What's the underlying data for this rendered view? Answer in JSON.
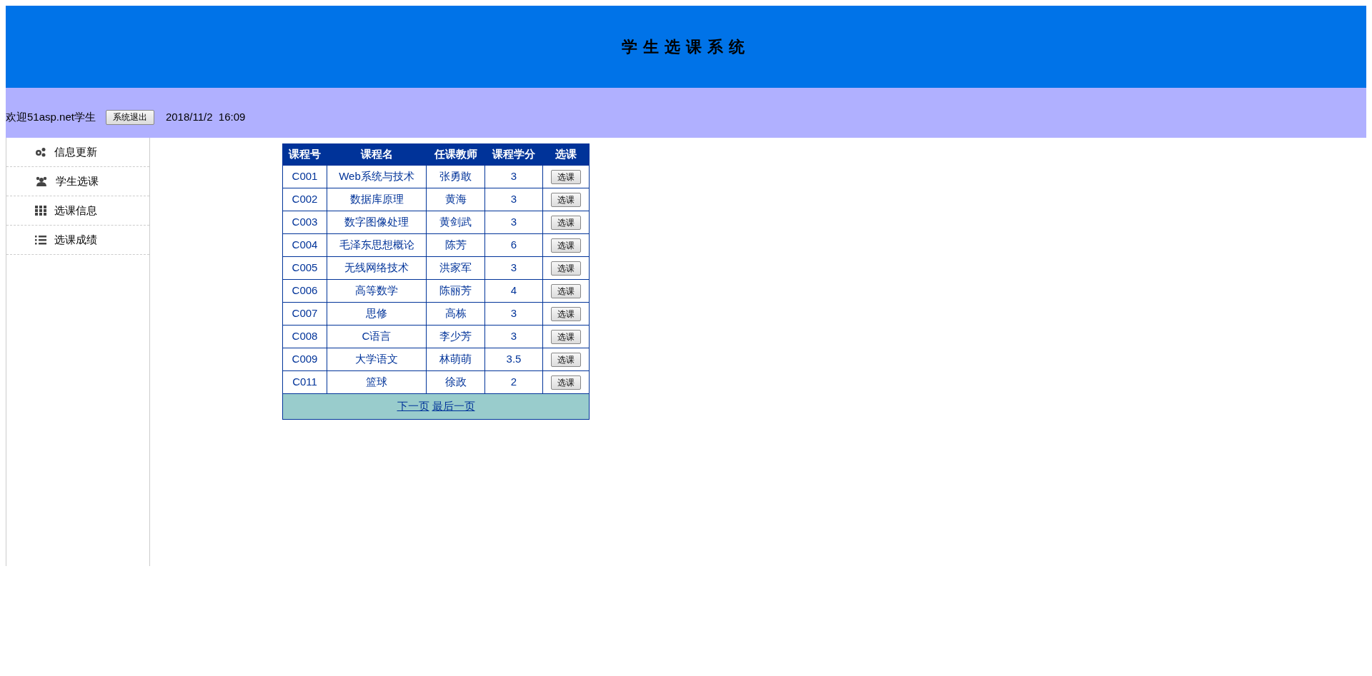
{
  "header": {
    "title": "学生选课系统"
  },
  "user_bar": {
    "welcome": "欢迎51asp.net学生",
    "logout_button": "系统退出",
    "datetime": "2018/11/2  16:09"
  },
  "sidebar": {
    "items": [
      {
        "label": "信息更新",
        "kind": "gears"
      },
      {
        "label": "学生选课",
        "kind": "users"
      },
      {
        "label": "选课信息",
        "kind": "grid"
      },
      {
        "label": "选课成绩",
        "kind": "list"
      }
    ]
  },
  "table": {
    "columns": [
      "课程号",
      "课程名",
      "任课教师",
      "课程学分",
      "选课"
    ],
    "rows": [
      {
        "id": "C001",
        "name": "Web系统与技术",
        "teacher": "张勇敢",
        "credits": "3",
        "action": "选课"
      },
      {
        "id": "C002",
        "name": "数据库原理",
        "teacher": "黄海",
        "credits": "3",
        "action": "选课"
      },
      {
        "id": "C003",
        "name": "数字图像处理",
        "teacher": "黄剑武",
        "credits": "3",
        "action": "选课"
      },
      {
        "id": "C004",
        "name": "毛泽东思想概论",
        "teacher": "陈芳",
        "credits": "6",
        "action": "选课"
      },
      {
        "id": "C005",
        "name": "无线网络技术",
        "teacher": "洪家军",
        "credits": "3",
        "action": "选课"
      },
      {
        "id": "C006",
        "name": "高等数学",
        "teacher": "陈丽芳",
        "credits": "4",
        "action": "选课"
      },
      {
        "id": "C007",
        "name": "思修",
        "teacher": "高栋",
        "credits": "3",
        "action": "选课"
      },
      {
        "id": "C008",
        "name": "C语言",
        "teacher": "李少芳",
        "credits": "3",
        "action": "选课"
      },
      {
        "id": "C009",
        "name": "大学语文",
        "teacher": "林萌萌",
        "credits": "3.5",
        "action": "选课"
      },
      {
        "id": "C011",
        "name": "篮球",
        "teacher": "徐政",
        "credits": "2",
        "action": "选课"
      }
    ],
    "pager": [
      "下一页",
      "最后一页"
    ]
  }
}
